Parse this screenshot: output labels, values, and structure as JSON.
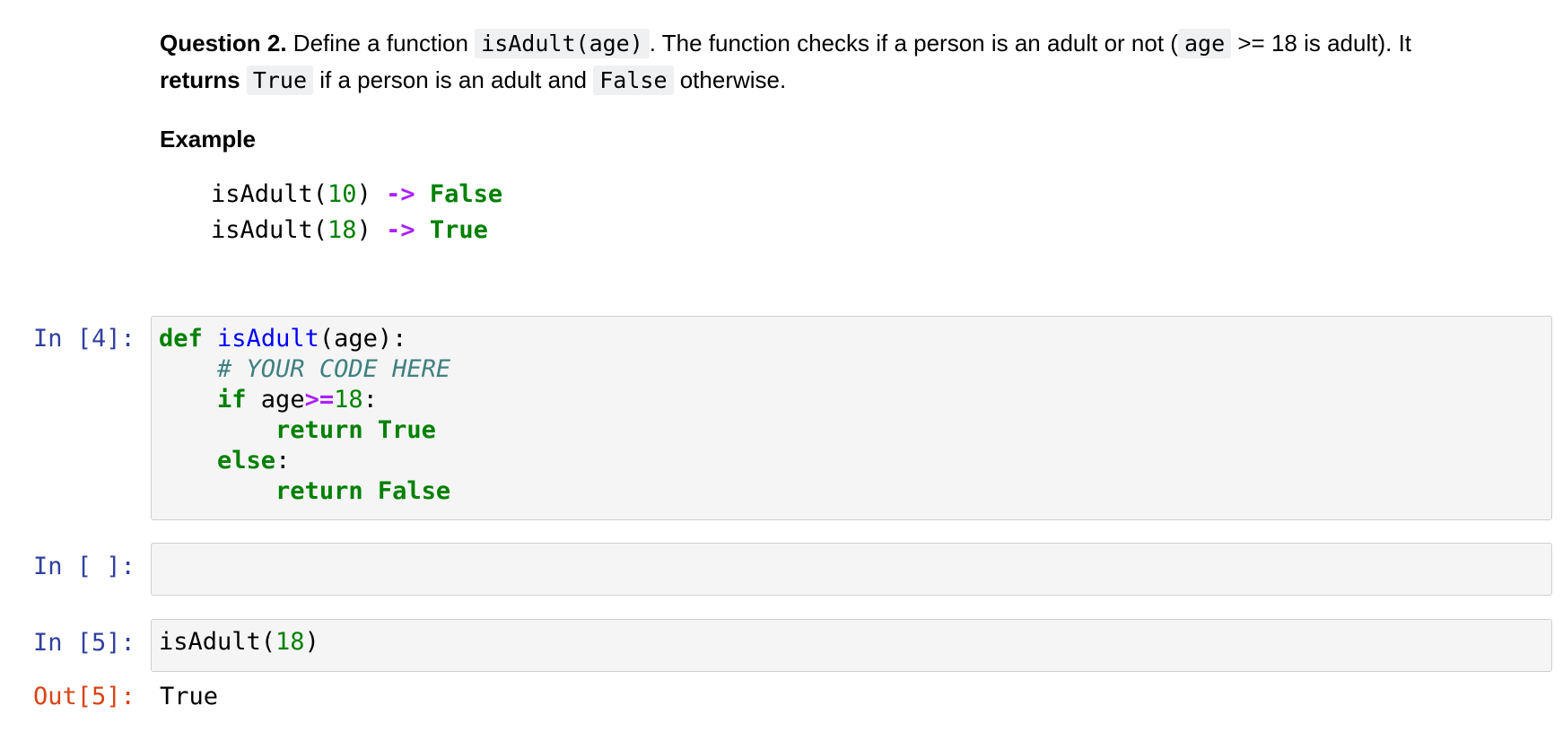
{
  "markdown": {
    "question_label": "Question 2.",
    "text_1": " Define a function ",
    "code_1": "isAdult(age)",
    "text_2": ". The function checks if a person is an adult or not (",
    "code_2": "age",
    "text_3": " >= 18 is adult). It",
    "bold_returns": "returns",
    "text_4": " ",
    "code_3": "True",
    "text_5": " if a person is an adult and ",
    "code_4": "False",
    "text_6": " otherwise.",
    "example_heading": "Example",
    "example_lines": [
      {
        "fn": "isAdult(",
        "arg": "10",
        "close": ") ",
        "arrow": "->",
        "space": " ",
        "result": "False"
      },
      {
        "fn": "isAdult(",
        "arg": "18",
        "close": ") ",
        "arrow": "->",
        "space": " ",
        "result": "True"
      }
    ]
  },
  "cells": [
    {
      "prompt": "In [4]:",
      "code": {
        "def_kw": "def",
        "fn_name": "isAdult",
        "params": "(age):",
        "comment": "# YOUR CODE HERE",
        "if_kw": "if",
        "cond_var": " age",
        "cond_op": ">=",
        "cond_num": "18",
        "colon": ":",
        "return_kw": "return",
        "true_val": "True",
        "else_kw": "else",
        "else_colon": ":",
        "return_kw2": "return",
        "false_val": "False"
      }
    },
    {
      "prompt": "In [ ]:",
      "code_text": ""
    },
    {
      "prompt": "In [5]:",
      "call_fn": "isAdult(",
      "call_arg": "18",
      "call_close": ")",
      "out_prompt": "Out[5]:",
      "output": "True"
    }
  ]
}
